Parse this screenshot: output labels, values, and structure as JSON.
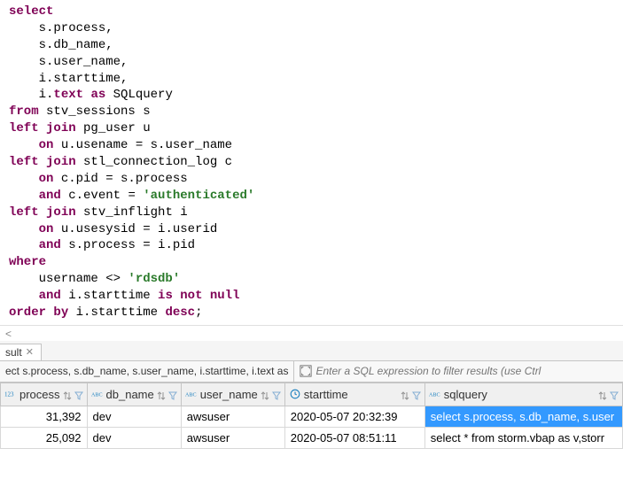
{
  "editor": {
    "tokens": [
      [
        {
          "t": "select",
          "c": "kw"
        }
      ],
      [
        {
          "t": "    s.process,",
          "c": "txt"
        }
      ],
      [
        {
          "t": "    s.db_name,",
          "c": "txt"
        }
      ],
      [
        {
          "t": "    s.user_name,",
          "c": "txt"
        }
      ],
      [
        {
          "t": "    i.starttime,",
          "c": "txt"
        }
      ],
      [
        {
          "t": "    i.",
          "c": "txt"
        },
        {
          "t": "text",
          "c": "kw"
        },
        {
          "t": " ",
          "c": "txt"
        },
        {
          "t": "as",
          "c": "kw"
        },
        {
          "t": " SQLquery",
          "c": "txt"
        }
      ],
      [
        {
          "t": "from",
          "c": "kw"
        },
        {
          "t": " stv_sessions s",
          "c": "txt"
        }
      ],
      [
        {
          "t": "left",
          "c": "kw"
        },
        {
          "t": " ",
          "c": "txt"
        },
        {
          "t": "join",
          "c": "kw"
        },
        {
          "t": " pg_user u",
          "c": "txt"
        }
      ],
      [
        {
          "t": "    ",
          "c": "txt"
        },
        {
          "t": "on",
          "c": "kw"
        },
        {
          "t": " u.usename = s.user_name",
          "c": "txt"
        }
      ],
      [
        {
          "t": "left",
          "c": "kw"
        },
        {
          "t": " ",
          "c": "txt"
        },
        {
          "t": "join",
          "c": "kw"
        },
        {
          "t": " stl_connection_log c",
          "c": "txt"
        }
      ],
      [
        {
          "t": "    ",
          "c": "txt"
        },
        {
          "t": "on",
          "c": "kw"
        },
        {
          "t": " c.pid = s.process",
          "c": "txt"
        }
      ],
      [
        {
          "t": "    ",
          "c": "txt"
        },
        {
          "t": "and",
          "c": "kw"
        },
        {
          "t": " c.event = ",
          "c": "txt"
        },
        {
          "t": "'authenticated'",
          "c": "str"
        }
      ],
      [
        {
          "t": "left",
          "c": "kw"
        },
        {
          "t": " ",
          "c": "txt"
        },
        {
          "t": "join",
          "c": "kw"
        },
        {
          "t": " stv_inflight i",
          "c": "txt"
        }
      ],
      [
        {
          "t": "    ",
          "c": "txt"
        },
        {
          "t": "on",
          "c": "kw"
        },
        {
          "t": " u.usesysid = i.userid",
          "c": "txt"
        }
      ],
      [
        {
          "t": "    ",
          "c": "txt"
        },
        {
          "t": "and",
          "c": "kw"
        },
        {
          "t": " s.process = i.pid",
          "c": "txt"
        }
      ],
      [
        {
          "t": "where",
          "c": "kw"
        }
      ],
      [
        {
          "t": "    username <> ",
          "c": "txt"
        },
        {
          "t": "'rdsdb'",
          "c": "str"
        }
      ],
      [
        {
          "t": "    ",
          "c": "txt"
        },
        {
          "t": "and",
          "c": "kw"
        },
        {
          "t": " i.starttime ",
          "c": "txt"
        },
        {
          "t": "is",
          "c": "kw"
        },
        {
          "t": " ",
          "c": "txt"
        },
        {
          "t": "not",
          "c": "kw"
        },
        {
          "t": " ",
          "c": "txt"
        },
        {
          "t": "null",
          "c": "kw"
        }
      ],
      [
        {
          "t": "order",
          "c": "kw"
        },
        {
          "t": " ",
          "c": "txt"
        },
        {
          "t": "by",
          "c": "kw"
        },
        {
          "t": " i.starttime ",
          "c": "txt"
        },
        {
          "t": "desc",
          "c": "kw"
        },
        {
          "t": ";",
          "c": "txt"
        }
      ]
    ]
  },
  "scroll_left_glyph": "<",
  "results": {
    "tab_label": "sult",
    "filter_summary": "ect s.process, s.db_name, s.user_name, i.starttime, i.text as",
    "filter_placeholder": "Enter a SQL expression to filter results (use Ctrl",
    "columns": [
      {
        "label": "process",
        "type": "number"
      },
      {
        "label": "db_name",
        "type": "text"
      },
      {
        "label": "user_name",
        "type": "text"
      },
      {
        "label": "starttime",
        "type": "datetime"
      },
      {
        "label": "sqlquery",
        "type": "text"
      }
    ],
    "rows": [
      {
        "process": "31,392",
        "db_name": "dev",
        "user_name": "awsuser",
        "starttime": "2020-05-07 20:32:39",
        "sqlquery": "select s.process, s.db_name, s.user",
        "selected_col": 4
      },
      {
        "process": "25,092",
        "db_name": "dev",
        "user_name": "awsuser",
        "starttime": "2020-05-07 08:51:11",
        "sqlquery": "select * from storm.vbap as v,storr"
      }
    ]
  },
  "icons": {
    "number_type": "123",
    "text_type": "ABC",
    "datetime_type": "clock"
  }
}
